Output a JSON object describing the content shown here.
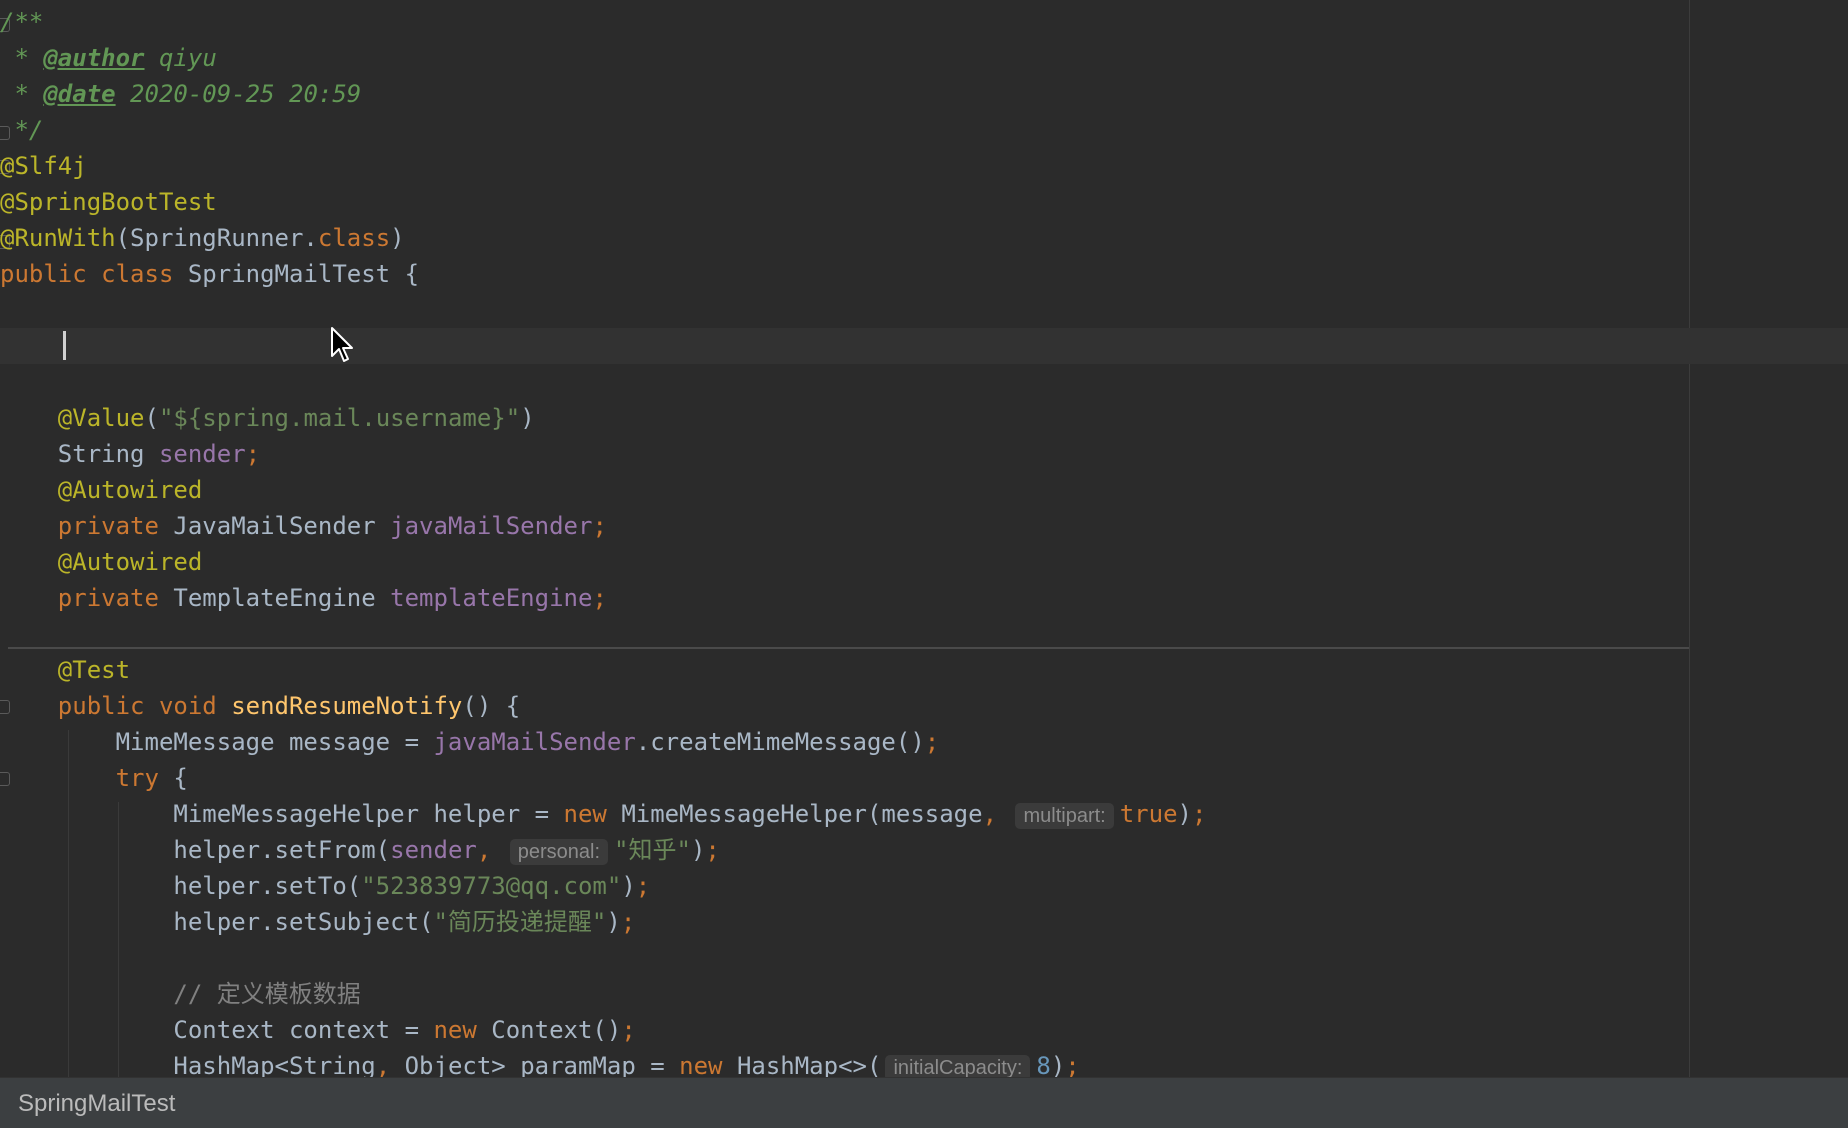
{
  "editor": {
    "theme": {
      "background": "#2b2b2b",
      "current_line": "#323232",
      "keyword": "#cc7832",
      "annotation": "#bbb529",
      "string": "#6a8759",
      "field": "#9876aa",
      "method": "#ffc66d",
      "number": "#6897bb",
      "doc_comment": "#629755",
      "comment": "#808080",
      "plain": "#a9b7c6"
    },
    "lines": [
      [
        {
          "t": "/**",
          "c": "comment-doc"
        }
      ],
      [
        {
          "t": " * ",
          "c": "comment-doc"
        },
        {
          "t": "@author",
          "c": "doc-tag"
        },
        {
          "t": " qiyu",
          "c": "comment-doc"
        }
      ],
      [
        {
          "t": " * ",
          "c": "comment-doc"
        },
        {
          "t": "@date",
          "c": "doc-tag"
        },
        {
          "t": " 2020-09-25 20:59",
          "c": "comment-doc"
        }
      ],
      [
        {
          "t": " */",
          "c": "comment-doc"
        }
      ],
      [
        {
          "t": "@Slf4j",
          "c": "annotation"
        }
      ],
      [
        {
          "t": "@SpringBootTest",
          "c": "annotation"
        }
      ],
      [
        {
          "t": "@RunWith",
          "c": "annotation"
        },
        {
          "t": "(SpringRunner.",
          "c": "plain"
        },
        {
          "t": "class",
          "c": "keyword"
        },
        {
          "t": ")",
          "c": "plain"
        }
      ],
      [
        {
          "t": "public class ",
          "c": "keyword"
        },
        {
          "t": "SpringMailTest {",
          "c": "plain"
        }
      ],
      [],
      [],
      [],
      [
        {
          "t": "    ",
          "c": "plain"
        },
        {
          "t": "@Value",
          "c": "annotation"
        },
        {
          "t": "(",
          "c": "plain"
        },
        {
          "t": "\"${spring.mail.username}\"",
          "c": "string"
        },
        {
          "t": ")",
          "c": "plain"
        }
      ],
      [
        {
          "t": "    String ",
          "c": "plain"
        },
        {
          "t": "sender",
          "c": "field"
        },
        {
          "t": ";",
          "c": "punct"
        }
      ],
      [
        {
          "t": "    ",
          "c": "plain"
        },
        {
          "t": "@Autowired",
          "c": "annotation"
        }
      ],
      [
        {
          "t": "    ",
          "c": "plain"
        },
        {
          "t": "private ",
          "c": "keyword"
        },
        {
          "t": "JavaMailSender ",
          "c": "plain"
        },
        {
          "t": "javaMailSender",
          "c": "field"
        },
        {
          "t": ";",
          "c": "punct"
        }
      ],
      [
        {
          "t": "    ",
          "c": "plain"
        },
        {
          "t": "@Autowired",
          "c": "annotation"
        }
      ],
      [
        {
          "t": "    ",
          "c": "plain"
        },
        {
          "t": "private ",
          "c": "keyword"
        },
        {
          "t": "TemplateEngine ",
          "c": "plain"
        },
        {
          "t": "templateEngine",
          "c": "field"
        },
        {
          "t": ";",
          "c": "punct"
        }
      ],
      [],
      [
        {
          "t": "    ",
          "c": "plain"
        },
        {
          "t": "@Test",
          "c": "annotation"
        }
      ],
      [
        {
          "t": "    ",
          "c": "plain"
        },
        {
          "t": "public void ",
          "c": "keyword"
        },
        {
          "t": "sendResumeNotify",
          "c": "method"
        },
        {
          "t": "() {",
          "c": "plain"
        }
      ],
      [
        {
          "t": "        MimeMessage message = ",
          "c": "plain"
        },
        {
          "t": "javaMailSender",
          "c": "field"
        },
        {
          "t": ".createMimeMessage()",
          "c": "plain"
        },
        {
          "t": ";",
          "c": "punct"
        }
      ],
      [
        {
          "t": "        ",
          "c": "plain"
        },
        {
          "t": "try ",
          "c": "keyword"
        },
        {
          "t": "{",
          "c": "plain"
        }
      ],
      [
        {
          "t": "            MimeMessageHelper helper = ",
          "c": "plain"
        },
        {
          "t": "new ",
          "c": "keyword"
        },
        {
          "t": "MimeMessageHelper(message",
          "c": "plain"
        },
        {
          "t": ", ",
          "c": "punct"
        },
        {
          "t": "multipart:",
          "c": "hint"
        },
        {
          "t": "true",
          "c": "keyword"
        },
        {
          "t": ")",
          "c": "plain"
        },
        {
          "t": ";",
          "c": "punct"
        }
      ],
      [
        {
          "t": "            helper.setFrom(",
          "c": "plain"
        },
        {
          "t": "sender",
          "c": "field"
        },
        {
          "t": ", ",
          "c": "punct"
        },
        {
          "t": "personal:",
          "c": "hint"
        },
        {
          "t": "\"知乎\"",
          "c": "string"
        },
        {
          "t": ")",
          "c": "plain"
        },
        {
          "t": ";",
          "c": "punct"
        }
      ],
      [
        {
          "t": "            helper.setTo(",
          "c": "plain"
        },
        {
          "t": "\"523839773@qq.com\"",
          "c": "string"
        },
        {
          "t": ")",
          "c": "plain"
        },
        {
          "t": ";",
          "c": "punct"
        }
      ],
      [
        {
          "t": "            helper.setSubject(",
          "c": "plain"
        },
        {
          "t": "\"简历投递提醒\"",
          "c": "string"
        },
        {
          "t": ")",
          "c": "plain"
        },
        {
          "t": ";",
          "c": "punct"
        }
      ],
      [],
      [
        {
          "t": "            ",
          "c": "plain"
        },
        {
          "t": "// 定义模板数据",
          "c": "comment"
        }
      ],
      [
        {
          "t": "            Context context = ",
          "c": "plain"
        },
        {
          "t": "new ",
          "c": "keyword"
        },
        {
          "t": "Context()",
          "c": "plain"
        },
        {
          "t": ";",
          "c": "punct"
        }
      ],
      [
        {
          "t": "            HashMap<String",
          "c": "plain"
        },
        {
          "t": ", ",
          "c": "punct"
        },
        {
          "t": "Object> paramMap = ",
          "c": "plain"
        },
        {
          "t": "new ",
          "c": "keyword"
        },
        {
          "t": "HashMap<>(",
          "c": "plain"
        },
        {
          "t": "initialCapacity:",
          "c": "hint"
        },
        {
          "t": "8",
          "c": "number"
        },
        {
          "t": ")",
          "c": "plain"
        },
        {
          "t": ";",
          "c": "punct"
        }
      ]
    ],
    "current_line_index": 9
  },
  "status_bar": {
    "breadcrumb": "SpringMailTest"
  }
}
